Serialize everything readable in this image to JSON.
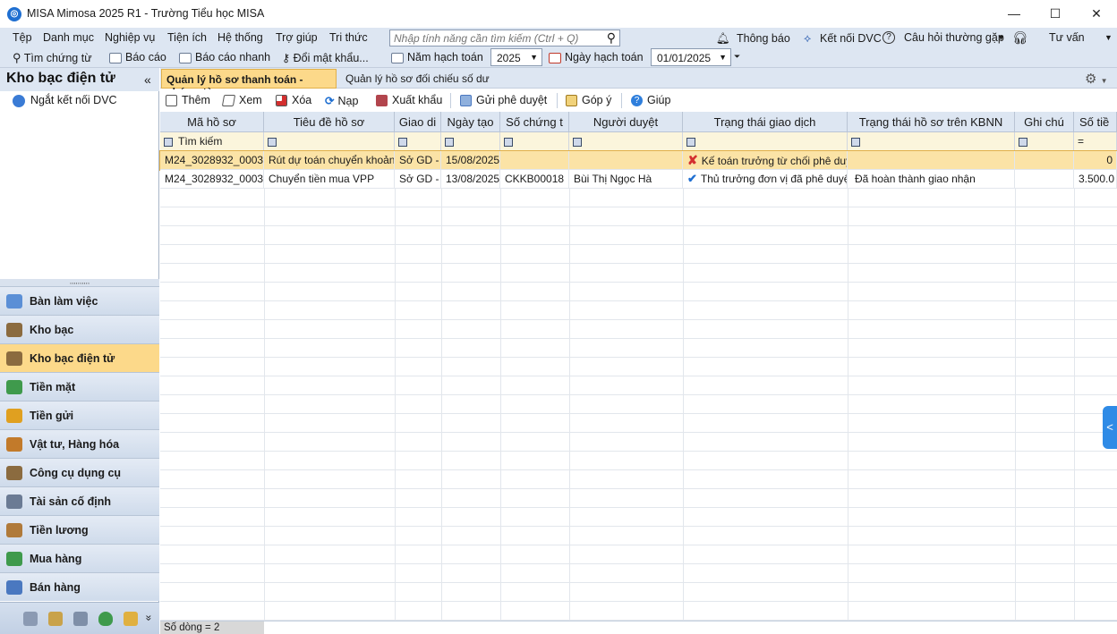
{
  "window": {
    "title": "MISA Mimosa 2025 R1 - Trường Tiểu học MISA",
    "minimize": "—",
    "maximize": "☐",
    "close": "✕"
  },
  "menu": {
    "items": [
      "Tệp",
      "Danh mục",
      "Nghiệp vụ",
      "Tiện ích",
      "Hệ thống",
      "Trợ giúp",
      "Tri thức"
    ],
    "search_placeholder": "Nhập tính năng cần tìm kiếm (Ctrl + Q)",
    "notifications": "Thông báo",
    "dvc": "Kết nối DVC",
    "faq": "Câu hỏi thường gặp",
    "consult": "Tư vấn"
  },
  "toolbar": {
    "find_voucher": "Tìm chứng từ",
    "report": "Báo cáo",
    "quick_report": "Báo cáo nhanh",
    "change_password": "Đổi mật khẩu...",
    "fiscal_year_label": "Năm hạch toán",
    "fiscal_year": "2025",
    "posting_date_label": "Ngày hạch toán",
    "posting_date": "01/01/2025"
  },
  "left": {
    "title": "Kho bạc điện tử",
    "collapse": "«",
    "disconnect": "Ngắt kết nối DVC",
    "grip": ",,,,,,,,,,",
    "nav": [
      {
        "label": "Bàn làm việc",
        "color": "#5b8fd6"
      },
      {
        "label": "Kho bạc",
        "color": "#8b6b3f"
      },
      {
        "label": "Kho bạc điện tử",
        "color": "#8b6b3f"
      },
      {
        "label": "Tiền mặt",
        "color": "#3f9a4c"
      },
      {
        "label": "Tiền gửi",
        "color": "#e0a020"
      },
      {
        "label": "Vật tư, Hàng hóa",
        "color": "#c27a2a"
      },
      {
        "label": "Công cụ dụng cụ",
        "color": "#8b6b3f"
      },
      {
        "label": "Tài sản cố định",
        "color": "#6b7b94"
      },
      {
        "label": "Tiền lương",
        "color": "#b07a3a"
      },
      {
        "label": "Mua hàng",
        "color": "#3f9a4c"
      },
      {
        "label": "Bán hàng",
        "color": "#4a78c0"
      }
    ],
    "more": "»"
  },
  "tabs": {
    "active": "Quản lý hồ sơ thanh toán - chứng từ",
    "other": "Quản lý hồ sơ đối chiếu số dư"
  },
  "actions": {
    "add": "Thêm",
    "view": "Xem",
    "delete": "Xóa",
    "load": "Nạp",
    "export": "Xuất khẩu",
    "send_approval": "Gửi phê duyệt",
    "feedback": "Góp ý",
    "help": "Giúp"
  },
  "grid": {
    "columns": [
      "Mã hồ sơ",
      "Tiêu đề hồ sơ",
      "Giao di",
      "Ngày tạo",
      "Số chứng t",
      "Người duyệt",
      "Trạng thái giao dịch",
      "Trạng thái hồ sơ trên KBNN",
      "Ghi chú",
      "Số tiề"
    ],
    "filter_search": "Tìm kiếm",
    "filter_last": "=",
    "rows": [
      {
        "code": "M24_3028932_0003",
        "title": "Rút dự toán chuyển khoản",
        "trans": "Sở GD -",
        "date": "15/08/2025",
        "voucher": "",
        "approver": "",
        "status": "Kế toán trưởng từ chối phê duy",
        "kbnn": "",
        "note": "",
        "amount": "0"
      },
      {
        "code": "M24_3028932_0003",
        "title": "Chuyển tiền mua VPP",
        "trans": "Sở GD -",
        "date": "13/08/2025",
        "voucher": "CKKB00018",
        "approver": "Bùi Thị Ngọc Hà",
        "status": "Thủ trưởng đơn vị đã phê duyệt",
        "kbnn": "Đã hoàn thành giao nhận",
        "note": "",
        "amount": "3.500.0"
      }
    ]
  },
  "status": {
    "row_count": "Số dòng = 2"
  }
}
